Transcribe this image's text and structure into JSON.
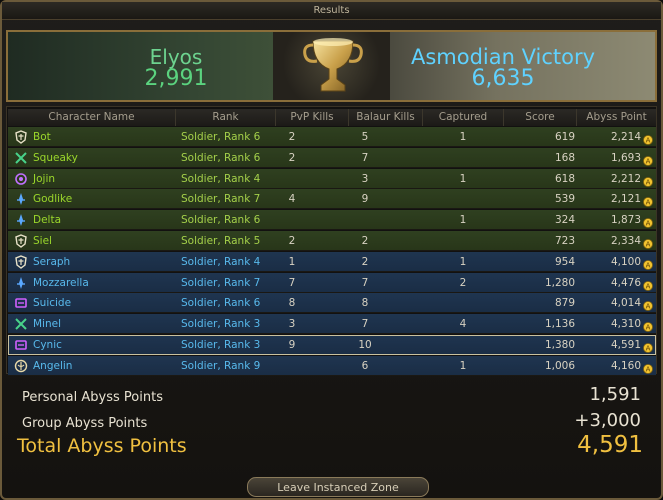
{
  "window": {
    "title": "Results"
  },
  "banner": {
    "elyos_name": "Elyos",
    "elyos_score": "2,991",
    "asmodian_label": "Asmodian Victory",
    "asmodian_score": "6,635",
    "colors": {
      "elyos": "#6dd38f",
      "asmodian": "#5fd2ff"
    }
  },
  "table": {
    "headers": [
      "Character Name",
      "Rank",
      "PvP Kills",
      "Balaur Kills",
      "Captured",
      "Score",
      "Abyss Point"
    ],
    "rows": [
      {
        "icon": "templar-class-icon",
        "faction": "elyos",
        "name": "Bot",
        "rank": "Soldier, Rank 6",
        "pvp": "2",
        "balaur": "5",
        "captured": "1",
        "score": "619",
        "abyss": "2,214"
      },
      {
        "icon": "gladiator-class-icon",
        "faction": "elyos",
        "name": "Squeaky",
        "rank": "Soldier, Rank 6",
        "pvp": "2",
        "balaur": "7",
        "captured": "",
        "score": "168",
        "abyss": "1,693"
      },
      {
        "icon": "sorcerer-class-icon",
        "faction": "elyos",
        "name": "Jojin",
        "rank": "Soldier, Rank 4",
        "pvp": "",
        "balaur": "3",
        "captured": "1",
        "score": "618",
        "abyss": "2,212"
      },
      {
        "icon": "cleric-class-icon",
        "faction": "elyos",
        "name": "Godlike",
        "rank": "Soldier, Rank 7",
        "pvp": "4",
        "balaur": "9",
        "captured": "",
        "score": "539",
        "abyss": "2,121"
      },
      {
        "icon": "cleric-class-icon",
        "faction": "elyos",
        "name": "Delta",
        "rank": "Soldier, Rank 6",
        "pvp": "",
        "balaur": "",
        "captured": "1",
        "score": "324",
        "abyss": "1,873"
      },
      {
        "icon": "templar-class-icon",
        "faction": "elyos",
        "name": "Siel",
        "rank": "Soldier, Rank 5",
        "pvp": "2",
        "balaur": "2",
        "captured": "",
        "score": "723",
        "abyss": "2,334"
      },
      {
        "icon": "templar-class-icon",
        "faction": "asmodian",
        "name": "Seraph",
        "rank": "Soldier, Rank 4",
        "pvp": "1",
        "balaur": "2",
        "captured": "1",
        "score": "954",
        "abyss": "4,100"
      },
      {
        "icon": "cleric-class-icon",
        "faction": "asmodian",
        "name": "Mozzarella",
        "rank": "Soldier, Rank 7",
        "pvp": "7",
        "balaur": "7",
        "captured": "2",
        "score": "1,280",
        "abyss": "4,476"
      },
      {
        "icon": "spiritmaster-class-icon",
        "faction": "asmodian",
        "name": "Suicide",
        "rank": "Soldier, Rank 6",
        "pvp": "8",
        "balaur": "8",
        "captured": "",
        "score": "879",
        "abyss": "4,014"
      },
      {
        "icon": "gladiator-class-icon",
        "faction": "asmodian",
        "name": "Minel",
        "rank": "Soldier, Rank 3",
        "pvp": "3",
        "balaur": "7",
        "captured": "4",
        "score": "1,136",
        "abyss": "4,310"
      },
      {
        "icon": "spiritmaster-class-icon",
        "faction": "asmodian",
        "name": "Cynic",
        "rank": "Soldier, Rank 3",
        "pvp": "9",
        "balaur": "10",
        "captured": "",
        "score": "1,380",
        "abyss": "4,591",
        "selected": true
      },
      {
        "icon": "chanter-class-icon",
        "faction": "asmodian",
        "name": "Angelin",
        "rank": "Soldier, Rank 9",
        "pvp": "",
        "balaur": "6",
        "captured": "1",
        "score": "1,006",
        "abyss": "4,160"
      }
    ]
  },
  "summary": {
    "personal_label": "Personal Abyss Points",
    "personal_value": "1,591",
    "group_label": "Group Abyss Points",
    "group_value": "+3,000",
    "total_label": "Total Abyss Points",
    "total_value": "4,591"
  },
  "footer": {
    "leave_label": "Leave Instanced Zone"
  }
}
